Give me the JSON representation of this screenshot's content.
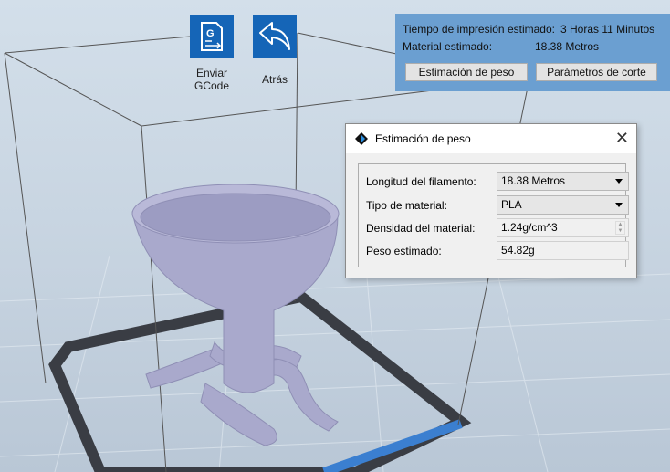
{
  "toolbar": {
    "send_gcode_label": "Enviar GCode",
    "send_gcode_line1": "Enviar",
    "send_gcode_line2": "GCode",
    "back_label": "Atrás"
  },
  "info_panel": {
    "time_label": "Tiempo de impresión estimado:",
    "time_value": "3 Horas 11 Minutos",
    "material_label": "Material estimado:",
    "material_value": "18.38 Metros",
    "weight_button": "Estimación de peso",
    "slice_params_button": "Parámetros de corte"
  },
  "dialog": {
    "title": "Estimación de peso",
    "fields": [
      {
        "label": "Longitud del filamento:",
        "value": "18.38 Metros"
      },
      {
        "label": "Tipo de material:",
        "value": "PLA"
      },
      {
        "label": "Densidad del material:",
        "value": "1.24g/cm^3"
      },
      {
        "label": "Peso estimado:",
        "value": "54.82g"
      }
    ]
  },
  "colors": {
    "accent": "#1565b7",
    "panel": "#6b9fd1",
    "model": "#a9a9cc"
  }
}
